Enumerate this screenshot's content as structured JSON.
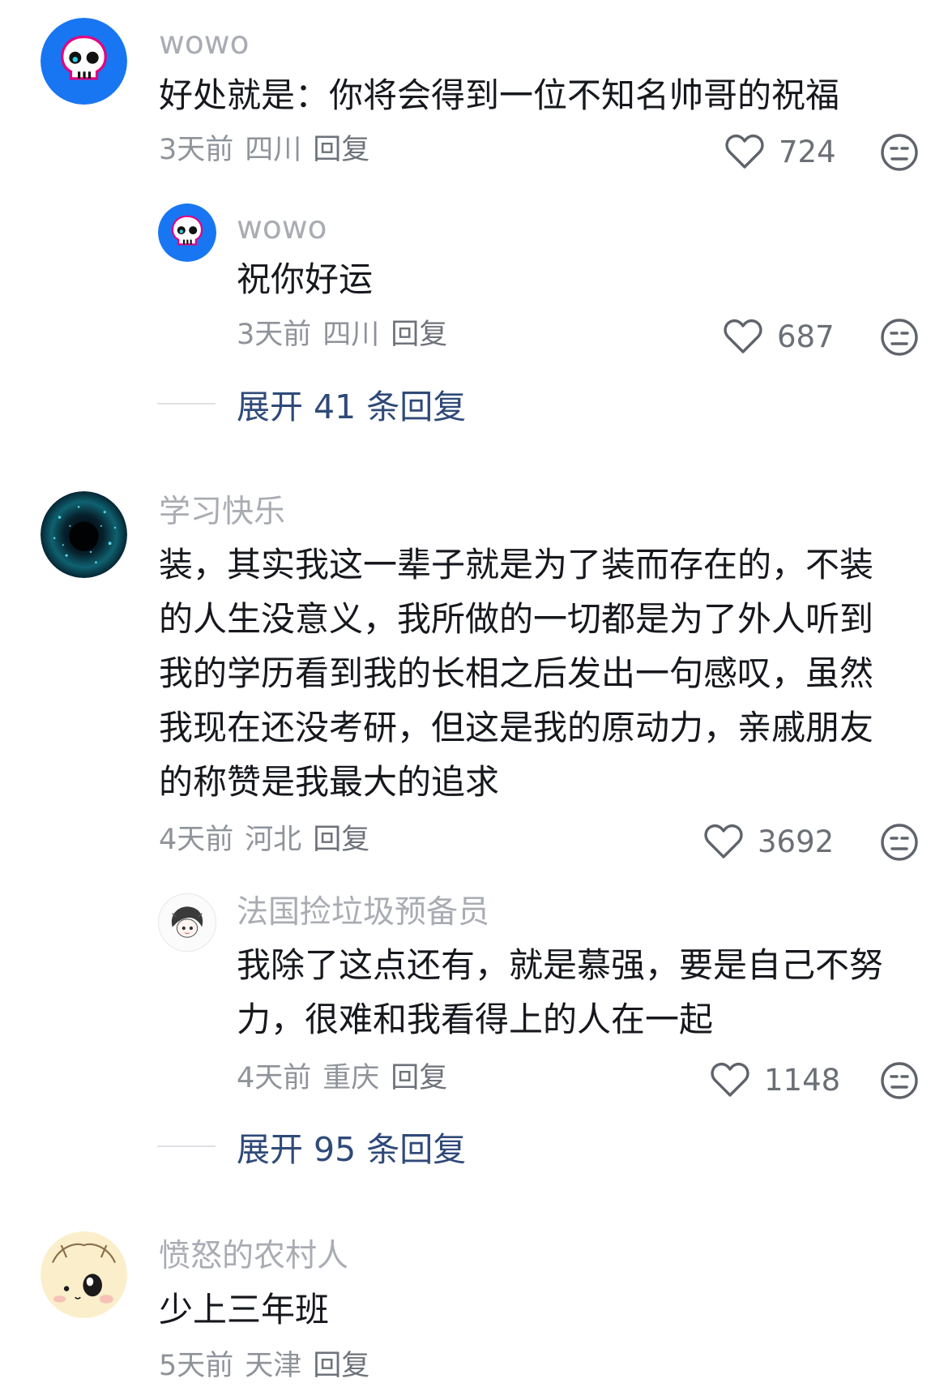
{
  "comments": [
    {
      "username": "wowo",
      "text": "好处就是：你将会得到一位不知名帅哥的祝福",
      "time": "3天前",
      "location": "四川",
      "reply_label": "回复",
      "likes": "724",
      "avatar_icon": "skull-icon",
      "replies": [
        {
          "username": "wowo",
          "text": "祝你好运",
          "time": "3天前",
          "location": "四川",
          "reply_label": "回复",
          "likes": "687",
          "avatar_icon": "skull-icon"
        }
      ],
      "expand_label": "展开 41 条回复"
    },
    {
      "username": "学习快乐",
      "text": "装，其实我这一辈子就是为了装而存在的，不装的人生没意义，我所做的一切都是为了外人听到我的学历看到我的长相之后发出一句感叹，虽然我现在还没考研，但这是我的原动力，亲戚朋友的称赞是我最大的追求",
      "time": "4天前",
      "location": "河北",
      "reply_label": "回复",
      "likes": "3692",
      "avatar_icon": "dark-galaxy-avatar",
      "replies": [
        {
          "username": "法国捡垃圾预备员",
          "text": "我除了这点还有，就是慕强，要是自己不努力，很难和我看得上的人在一起",
          "time": "4天前",
          "location": "重庆",
          "reply_label": "回复",
          "likes": "1148",
          "avatar_icon": "anime-girl-avatar"
        }
      ],
      "expand_label": "展开 95 条回复"
    },
    {
      "username": "愤怒的农村人",
      "text": "少上三年班",
      "time": "5天前",
      "location": "天津",
      "reply_label": "回复",
      "avatar_icon": "cartoon-bunny-avatar"
    }
  ],
  "colors": {
    "username": "#a9acb3",
    "content": "#16181d",
    "meta": "#8f939a",
    "expand_link": "#2f4a79",
    "avatar_blue": "#1876f2"
  }
}
